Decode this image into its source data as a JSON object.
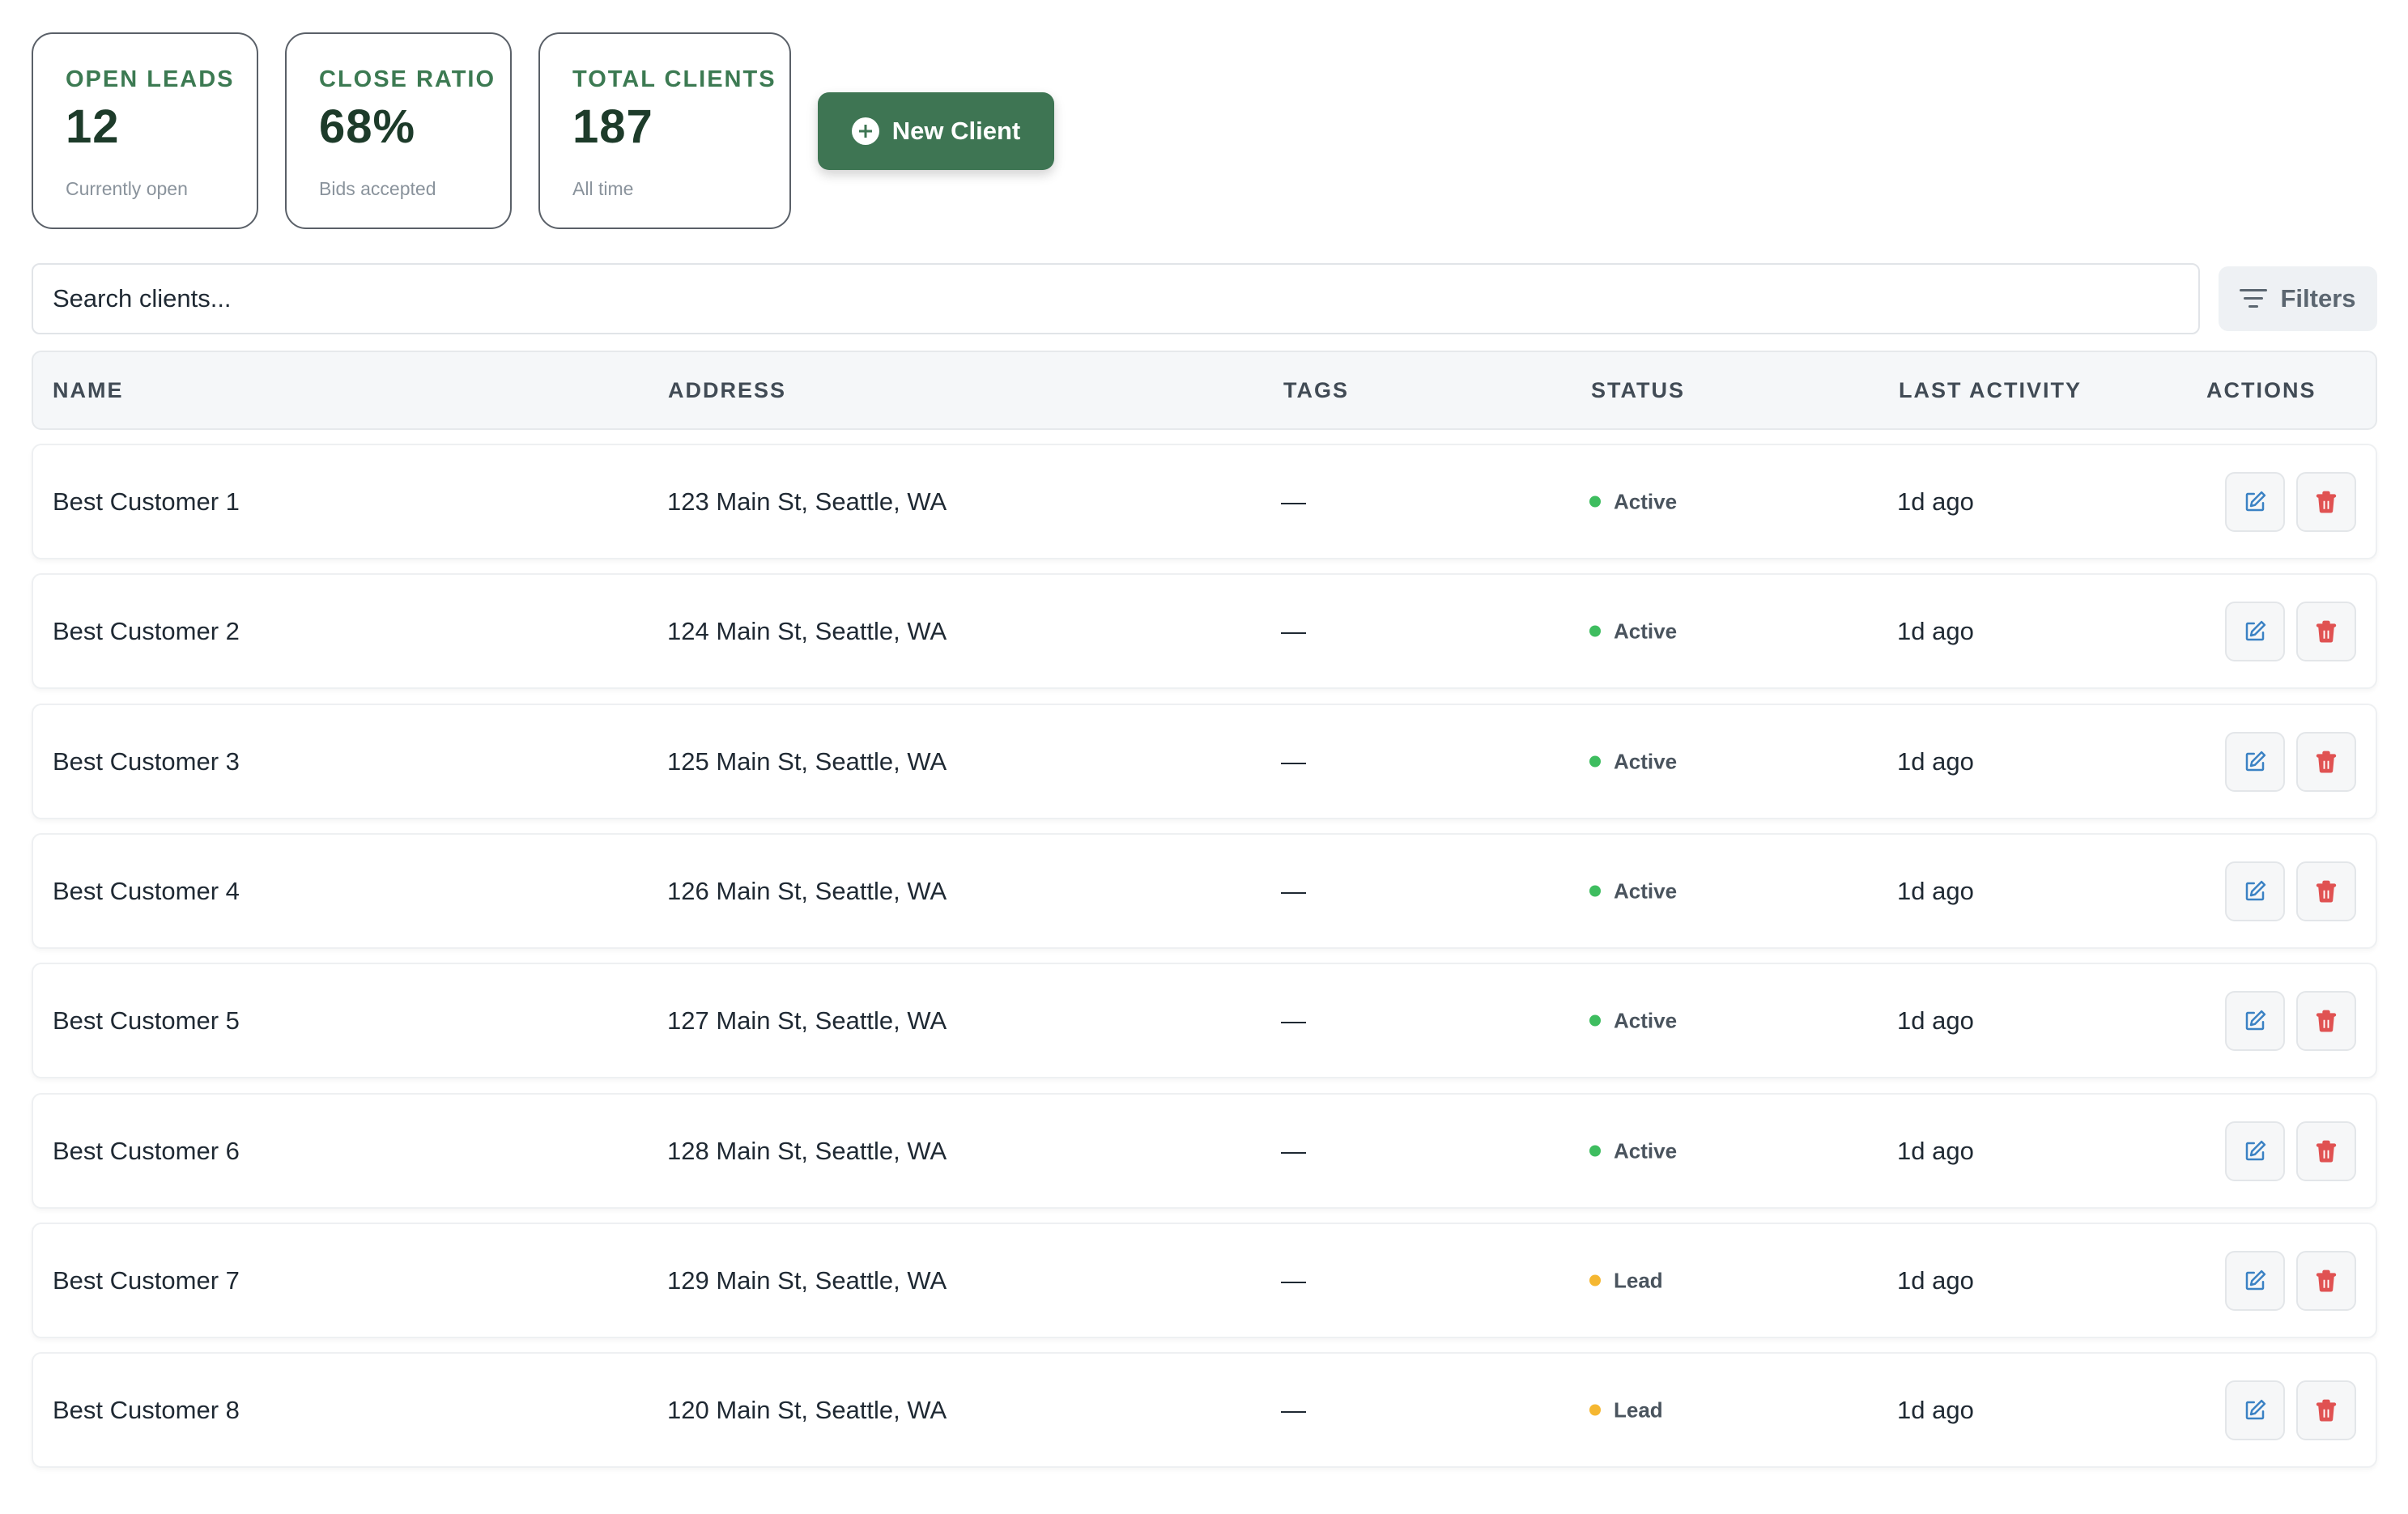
{
  "stats": [
    {
      "label": "OPEN LEADS",
      "value": "12",
      "sub": "Currently open"
    },
    {
      "label": "CLOSE RATIO",
      "value": "68%",
      "sub": "Bids accepted"
    },
    {
      "label": "TOTAL CLIENTS",
      "value": "187",
      "sub": "All time"
    }
  ],
  "new_client_label": "New Client",
  "search": {
    "placeholder": "Search clients..."
  },
  "filters_label": "Filters",
  "columns": [
    "NAME",
    "ADDRESS",
    "TAGS",
    "STATUS",
    "LAST ACTIVITY",
    "ACTIONS"
  ],
  "colors": {
    "active": "#3ebd5f",
    "lead": "#f5b731",
    "accent": "#3e7553",
    "edit": "#3b82c4",
    "delete": "#e05252"
  },
  "rows": [
    {
      "name": "Best Customer 1",
      "address": "123 Main St, Seattle, WA",
      "tags": "—",
      "status": "Active",
      "activity": "1d ago"
    },
    {
      "name": "Best Customer 2",
      "address": "124 Main St, Seattle, WA",
      "tags": "—",
      "status": "Active",
      "activity": "1d ago"
    },
    {
      "name": "Best Customer 3",
      "address": "125 Main St, Seattle, WA",
      "tags": "—",
      "status": "Active",
      "activity": "1d ago"
    },
    {
      "name": "Best Customer 4",
      "address": "126 Main St, Seattle, WA",
      "tags": "—",
      "status": "Active",
      "activity": "1d ago"
    },
    {
      "name": "Best Customer 5",
      "address": "127 Main St, Seattle, WA",
      "tags": "—",
      "status": "Active",
      "activity": "1d ago"
    },
    {
      "name": "Best Customer 6",
      "address": "128 Main St, Seattle, WA",
      "tags": "—",
      "status": "Active",
      "activity": "1d ago"
    },
    {
      "name": "Best Customer 7",
      "address": "129 Main St, Seattle, WA",
      "tags": "—",
      "status": "Lead",
      "activity": "1d ago"
    },
    {
      "name": "Best Customer 8",
      "address": "120 Main St, Seattle, WA",
      "tags": "—",
      "status": "Lead",
      "activity": "1d ago"
    }
  ]
}
